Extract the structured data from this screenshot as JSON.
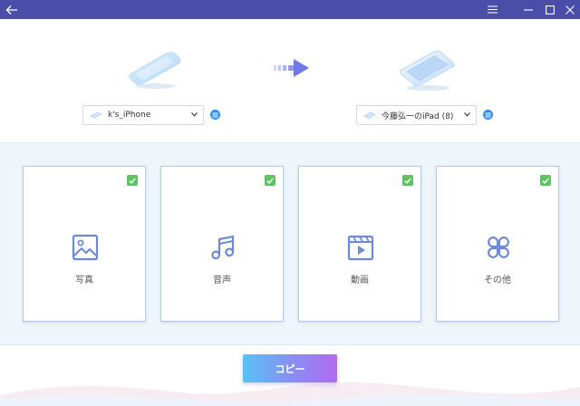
{
  "titlebar": {
    "background": "#4a4ea8",
    "icons": [
      "back-arrow-icon",
      "menu-icon",
      "minimize-icon",
      "maximize-icon",
      "close-icon"
    ]
  },
  "source_device": {
    "selected": "k's_iPhone",
    "icon": "phone-icon"
  },
  "target_device": {
    "selected": "今藤弘一のiPad (8)",
    "icon": "ipad-icon"
  },
  "categories": [
    {
      "label": "写真",
      "icon": "photo-icon",
      "checked": true
    },
    {
      "label": "音声",
      "icon": "music-note-icon",
      "checked": true
    },
    {
      "label": "動画",
      "icon": "video-clapper-icon",
      "checked": true
    },
    {
      "label": "その他",
      "icon": "other-grid-icon",
      "checked": true
    }
  ],
  "action": {
    "copy_label": "コピー"
  },
  "colors": {
    "accent": "#2f8ff0",
    "check": "#5fc45f",
    "card_border": "#b7c9ec",
    "icon": "#6d8ad9"
  }
}
